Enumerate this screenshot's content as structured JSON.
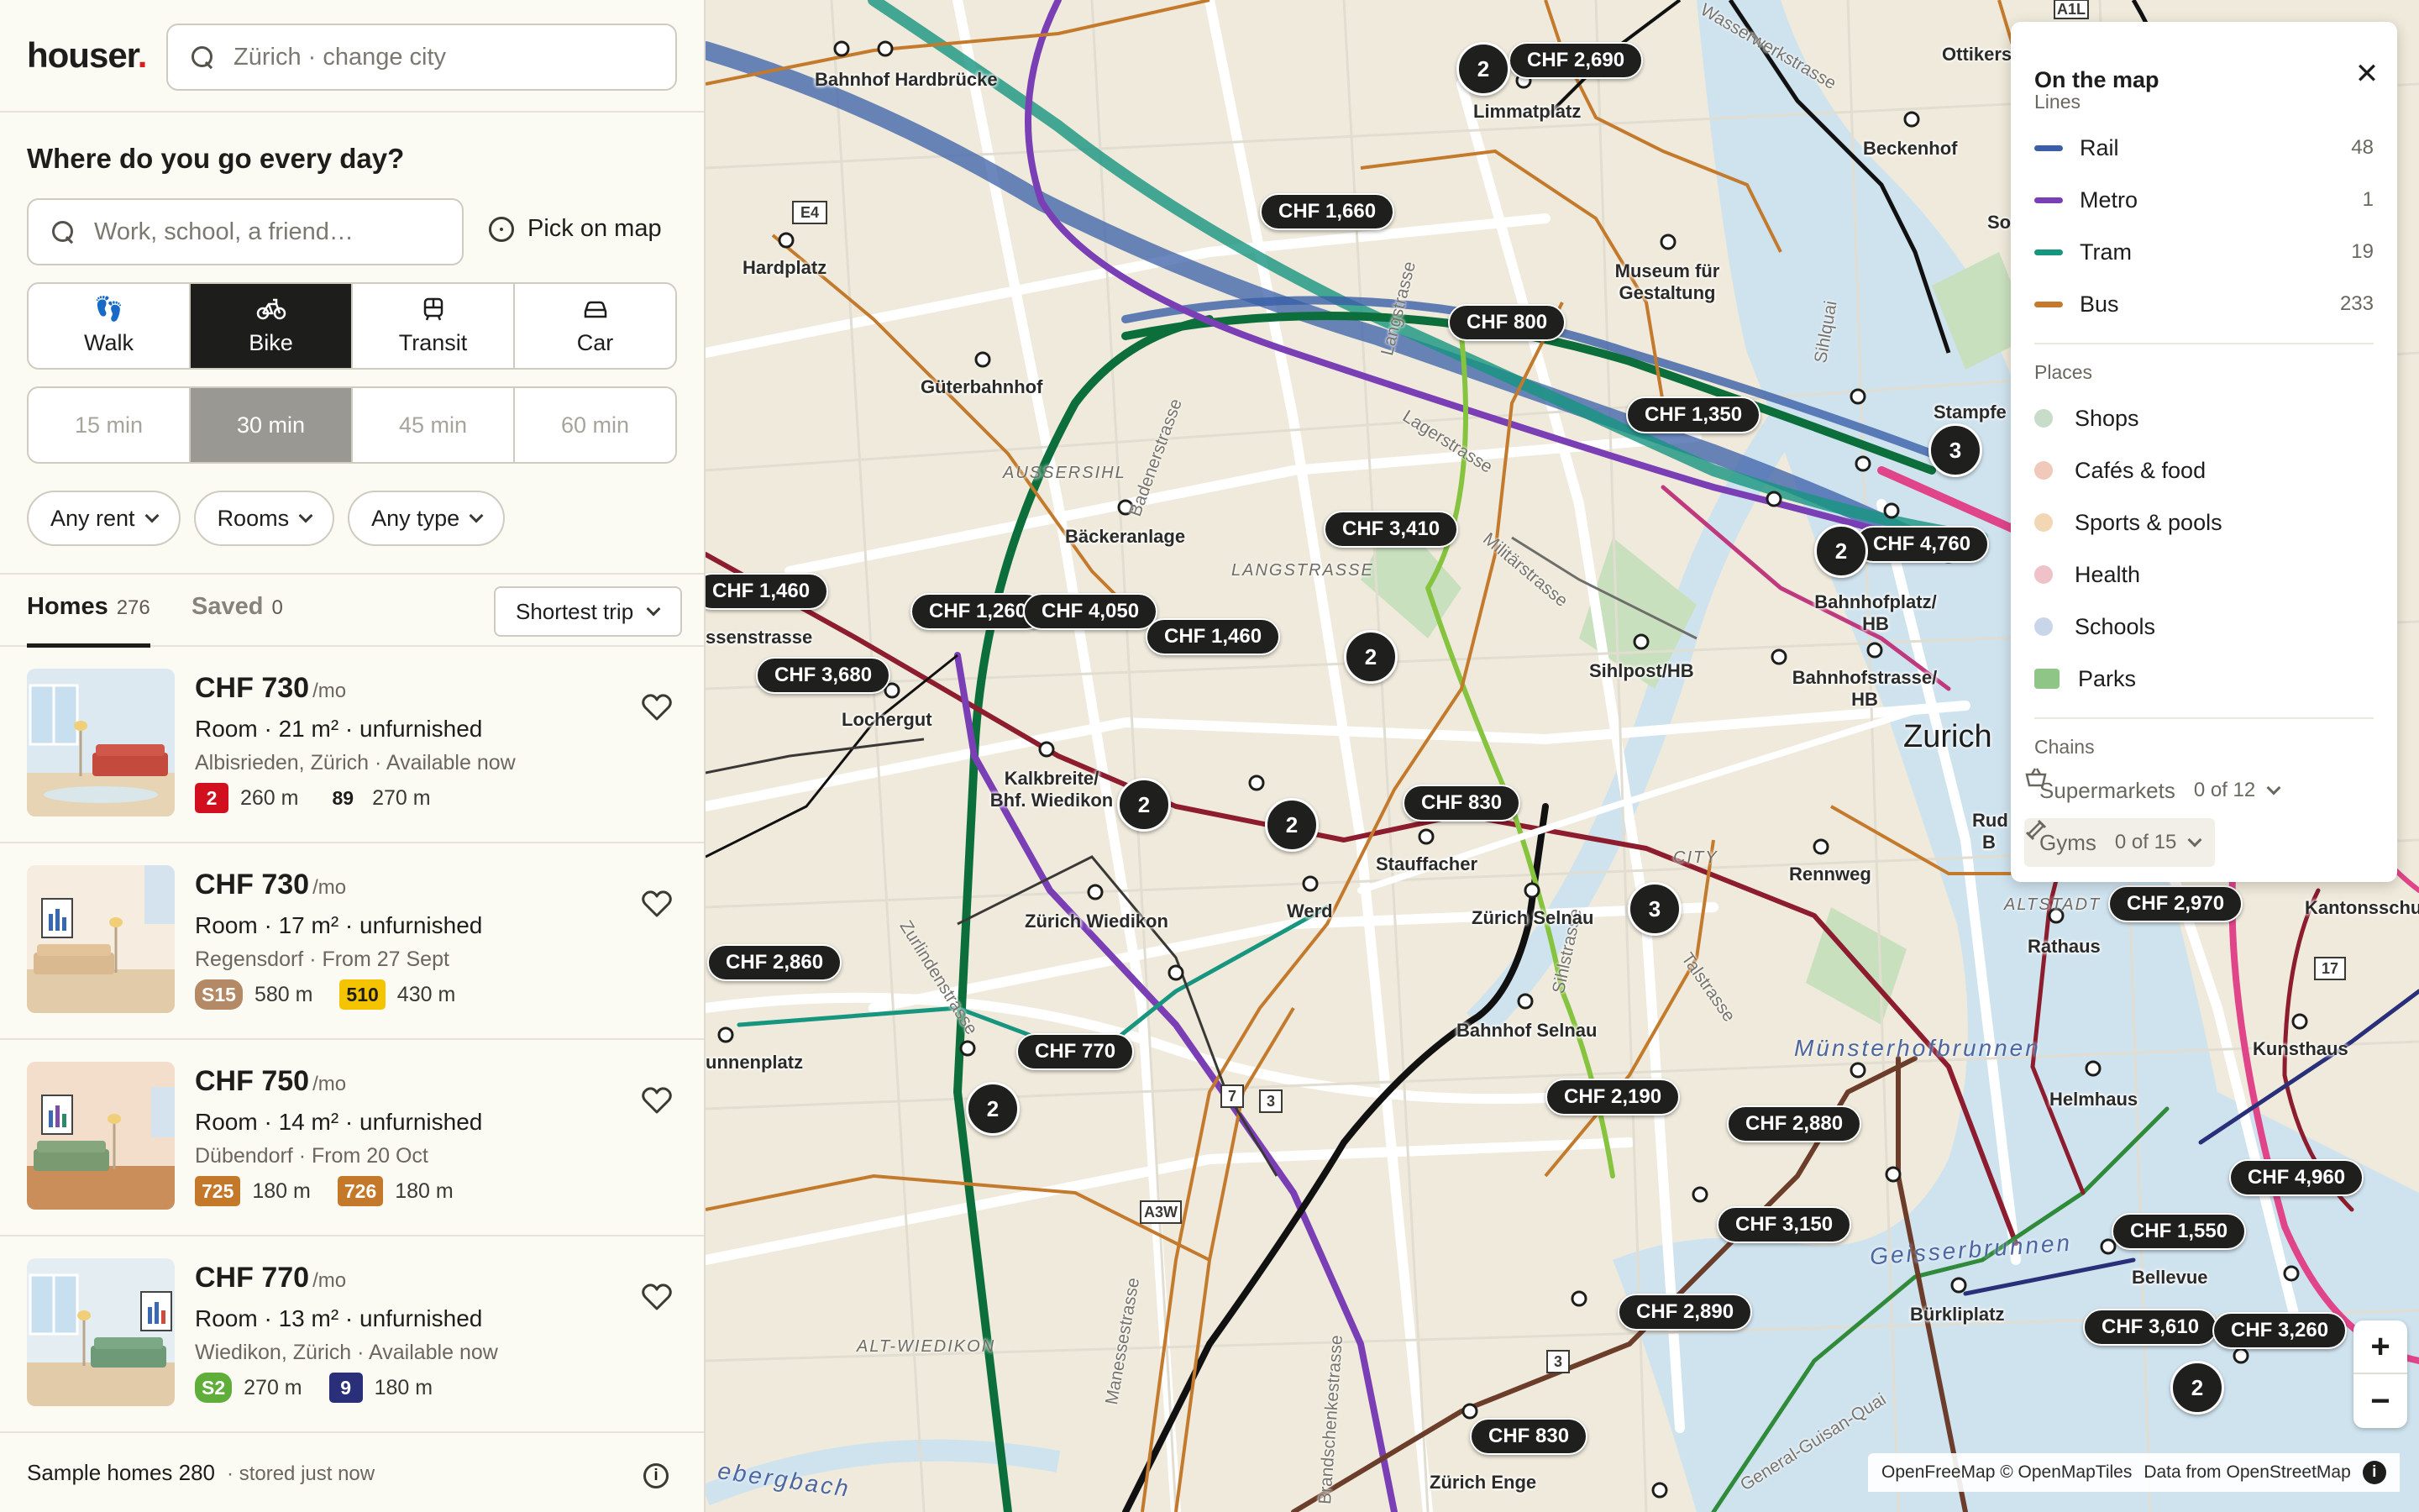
{
  "app": {
    "logo": "houser",
    "city_search_placeholder": "Zürich · change city"
  },
  "commute": {
    "question": "Where do you go every day?",
    "destination_placeholder": "Work, school, a friend…",
    "pick_on_map": "Pick on map",
    "modes": [
      {
        "label": "Walk",
        "icon": "walk-icon",
        "active": false
      },
      {
        "label": "Bike",
        "icon": "bike-icon",
        "active": true
      },
      {
        "label": "Transit",
        "icon": "transit-icon",
        "active": false
      },
      {
        "label": "Car",
        "icon": "car-icon",
        "active": false
      }
    ],
    "times": [
      {
        "label": "15 min",
        "active": false
      },
      {
        "label": "30 min",
        "active": true
      },
      {
        "label": "45 min",
        "active": false
      },
      {
        "label": "60 min",
        "active": false
      }
    ]
  },
  "filters": {
    "rent": "Any rent",
    "rooms": "Rooms",
    "type": "Any type"
  },
  "tabs": {
    "homes_label": "Homes",
    "homes_count": "276",
    "saved_label": "Saved",
    "saved_count": "0",
    "sort_selected": "Shortest trip"
  },
  "listings": [
    {
      "price": "CHF 730",
      "per": "/mo",
      "desc": "Room · 21 m² · unfurnished",
      "location": "Albisrieden, Zürich · Available now",
      "lines": [
        {
          "badge": "2",
          "color": "#d10f1f",
          "text_color": "#ffffff",
          "distance": "260 m"
        },
        {
          "badge": "89",
          "color": "transparent",
          "text_color": "#1d1d1b",
          "distance": "270 m"
        }
      ]
    },
    {
      "price": "CHF 730",
      "per": "/mo",
      "desc": "Room · 17 m² · unfurnished",
      "location": "Regensdorf · From 27 Sept",
      "lines": [
        {
          "badge": "S15",
          "color": "#b48a66",
          "text_color": "#ffffff",
          "distance": "580 m"
        },
        {
          "badge": "510",
          "color": "#f5c400",
          "text_color": "#1d1d1b",
          "distance": "430 m"
        }
      ]
    },
    {
      "price": "CHF 750",
      "per": "/mo",
      "desc": "Room · 14 m² · unfurnished",
      "location": "Dübendorf · From 20 Oct",
      "lines": [
        {
          "badge": "725",
          "color": "#c4782a",
          "text_color": "#ffffff",
          "distance": "180 m"
        },
        {
          "badge": "726",
          "color": "#c4782a",
          "text_color": "#ffffff",
          "distance": "180 m"
        }
      ]
    },
    {
      "price": "CHF 770",
      "per": "/mo",
      "desc": "Room · 13 m² · unfurnished",
      "location": "Wiedikon, Zürich · Available now",
      "lines": [
        {
          "badge": "S2",
          "color": "#5fae3a",
          "text_color": "#ffffff",
          "distance": "270 m"
        },
        {
          "badge": "9",
          "color": "#2a2f7a",
          "text_color": "#ffffff",
          "distance": "180 m"
        }
      ]
    }
  ],
  "footer": {
    "sample": "Sample homes 280",
    "stored": "· stored just now"
  },
  "map": {
    "price_pins": [
      "CHF 2,690",
      "CHF 1,660",
      "CHF 800",
      "CHF 1,350",
      "CHF 4,760",
      "CHF 3,410",
      "CHF 1,460",
      "CHF 1,260",
      "CHF 4,050",
      "CHF 1,460",
      "CHF 3,680",
      "CHF 830",
      "CHF 2,860",
      "CHF 770",
      "CHF 2,190",
      "CHF 2,880",
      "CHF 3,150",
      "CHF 2,890",
      "CHF 2,970",
      "CHF 4,960",
      "CHF 1,550",
      "CHF 3,610",
      "CHF 3,260",
      "CHF 830"
    ],
    "clusters": [
      "2",
      "3",
      "2",
      "2",
      "2",
      "2",
      "3",
      "2",
      "2"
    ],
    "stations": [
      "Bahnhof Hardbrücke",
      "Limmatplatz",
      "Hardplatz",
      "Museum für Gestaltung",
      "Beckenhof",
      "Güterbahnhof",
      "Bäckeranlage",
      "Stampfe",
      "Bahnhofplatz/ HB",
      "Sihlpost/HB",
      "Bahnhofstrasse/ HB",
      "Lochergut",
      "Kalkbreite/ Bhf. Wiedikon",
      "Stauffacher",
      "Zürich Wiedikon",
      "Werd",
      "Zürich Selnau",
      "Rennweg",
      "Bahnhof Selnau",
      "Rathaus",
      "Kunsthaus",
      "Helmhaus",
      "Bellevue",
      "Bürkliplatz",
      "Zürich Enge",
      "Ottikers",
      "Kantonsschu",
      "Rud B",
      "So",
      "ssenstrasse",
      "unnenplatz"
    ],
    "districts": [
      "AUSSERSIHL",
      "LANGSTRASSE",
      "CITY",
      "ALTSTADT",
      "ALT-WIEDIKON"
    ],
    "streets": [
      "Lagerstrasse",
      "Militärstrasse",
      "Badenerstrasse",
      "Talstrasse",
      "Zurlindenstrasse",
      "Brandschenkestrasse",
      "Manessestrasse",
      "Wasserwerkstrasse",
      "Sihlquai",
      "Sihlstrasse",
      "General-Guisan-Quai",
      "Langstrasse"
    ],
    "city": "Zurich",
    "areas": [
      "Münsterhofbrunnen",
      "Geisserbrunnen",
      "ebergbach"
    ],
    "road_signs": [
      "A1L",
      "A3W",
      "3",
      "7",
      "3",
      "E4",
      "17"
    ],
    "zoom_in": "+",
    "zoom_out": "−",
    "attribution": {
      "ofm": "OpenFreeMap © OpenMapTiles",
      "data_from": "Data from",
      "osm": "OpenStreetMap"
    },
    "colors": {
      "rail": "#3a5fa8",
      "metro": "#7b3fb5",
      "tram": "#16957f",
      "bus": "#c47a2c",
      "tram_line_2": "#8c1c2e",
      "tram_line_7": "#111111",
      "tram_line_13": "#86c440",
      "tram_line_5": "#6b3d2a"
    }
  },
  "legend": {
    "title": "On the map",
    "lines_heading": "Lines",
    "lines": [
      {
        "label": "Rail",
        "count": "48",
        "color": "#3a5fa8"
      },
      {
        "label": "Metro",
        "count": "1",
        "color": "#7b3fb5"
      },
      {
        "label": "Tram",
        "count": "19",
        "color": "#16957f"
      },
      {
        "label": "Bus",
        "count": "233",
        "color": "#c47a2c"
      }
    ],
    "places_heading": "Places",
    "places": [
      {
        "label": "Shops",
        "color": "#c7dcc9"
      },
      {
        "label": "Cafés & food",
        "color": "#f0c9bb"
      },
      {
        "label": "Sports & pools",
        "color": "#f3d7b4"
      },
      {
        "label": "Health",
        "color": "#eec2c8"
      },
      {
        "label": "Schools",
        "color": "#c9d6ea"
      },
      {
        "label": "Parks",
        "color": "#8fc587",
        "square": true
      }
    ],
    "chains_heading": "Chains",
    "chains": [
      {
        "label": "Supermarkets",
        "count": "0 of 12",
        "icon": "basket-icon"
      },
      {
        "label": "Gyms",
        "count": "0 of 15",
        "icon": "dumbbell-icon"
      }
    ]
  }
}
